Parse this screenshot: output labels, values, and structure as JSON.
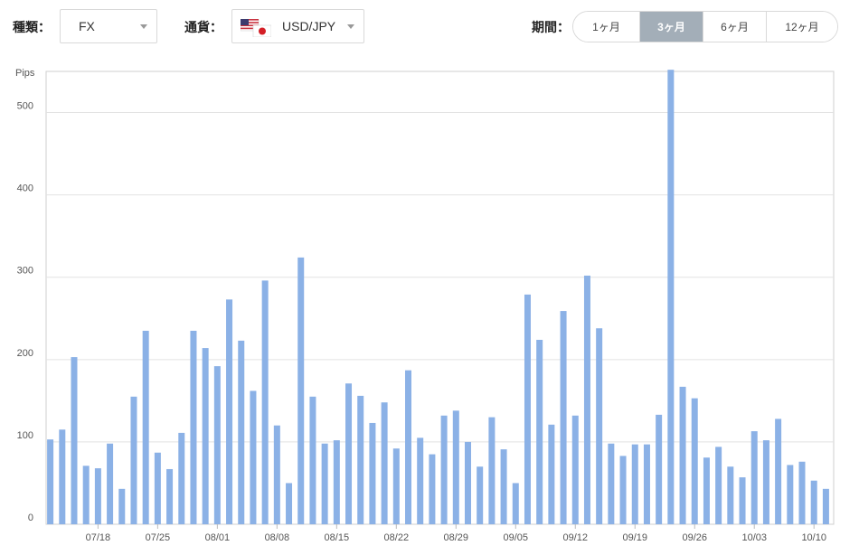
{
  "filters": {
    "type_label": "種類：",
    "type_value": "FX",
    "currency_label": "通貨：",
    "currency_value": "USD/JPY",
    "period_label": "期間：",
    "period_options": [
      "1ヶ月",
      "3ヶ月",
      "6ヶ月",
      "12ヶ月"
    ],
    "period_selected": "3ヶ月"
  },
  "colors": {
    "bar": "#8bb1e6",
    "active_period": "#a3aeb8",
    "grid": "#e2e2e2"
  },
  "chart_data": {
    "type": "bar",
    "ylabel": "Pips",
    "ylim": [
      0,
      550
    ],
    "yticks": [
      0,
      100,
      200,
      300,
      400,
      500
    ],
    "grid": true,
    "xtick_labels": [
      {
        "index": 4,
        "label": "07/18"
      },
      {
        "index": 9,
        "label": "07/25"
      },
      {
        "index": 14,
        "label": "08/01"
      },
      {
        "index": 19,
        "label": "08/08"
      },
      {
        "index": 24,
        "label": "08/15"
      },
      {
        "index": 29,
        "label": "08/22"
      },
      {
        "index": 34,
        "label": "08/29"
      },
      {
        "index": 39,
        "label": "09/05"
      },
      {
        "index": 44,
        "label": "09/12"
      },
      {
        "index": 49,
        "label": "09/19"
      },
      {
        "index": 54,
        "label": "09/26"
      },
      {
        "index": 59,
        "label": "10/03"
      },
      {
        "index": 64,
        "label": "10/10"
      }
    ],
    "values": [
      103,
      115,
      203,
      71,
      68,
      98,
      43,
      155,
      235,
      87,
      67,
      111,
      235,
      214,
      192,
      273,
      223,
      162,
      296,
      120,
      50,
      324,
      155,
      98,
      102,
      171,
      156,
      123,
      148,
      92,
      187,
      105,
      85,
      132,
      138,
      100,
      70,
      130,
      91,
      50,
      279,
      224,
      121,
      259,
      132,
      302,
      238,
      98,
      83,
      97,
      97,
      133,
      552,
      167,
      153,
      81,
      94,
      70,
      57,
      113,
      102,
      128,
      72,
      76,
      53,
      43
    ]
  }
}
